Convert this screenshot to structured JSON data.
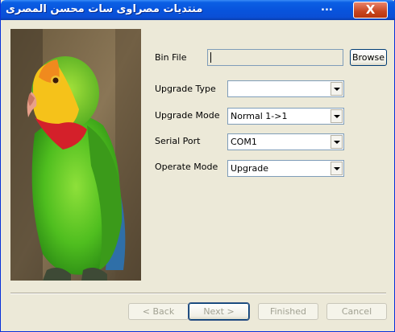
{
  "window": {
    "title": "منتديات مصراوى سات  محسن المصرى",
    "title_extra": "...",
    "close_label": "X"
  },
  "form": {
    "bin_file": {
      "label": "Bin File",
      "value": "",
      "browse_label": "Browse"
    },
    "upgrade_type": {
      "label": "Upgrade Type",
      "value": ""
    },
    "upgrade_mode": {
      "label": "Upgrade Mode",
      "value": "Normal 1->1"
    },
    "serial_port": {
      "label": "Serial Port",
      "value": "COM1"
    },
    "operate_mode": {
      "label": "Operate Mode",
      "value": "Upgrade"
    }
  },
  "footer": {
    "back_label": "< Back",
    "next_label": "Next >",
    "finished_label": "Finished",
    "cancel_label": "Cancel"
  },
  "colors": {
    "titlebar": "#0854dd",
    "window_bg": "#ece9d8",
    "close_button": "#c7451f"
  },
  "image": {
    "subject": "parrot-photo"
  }
}
